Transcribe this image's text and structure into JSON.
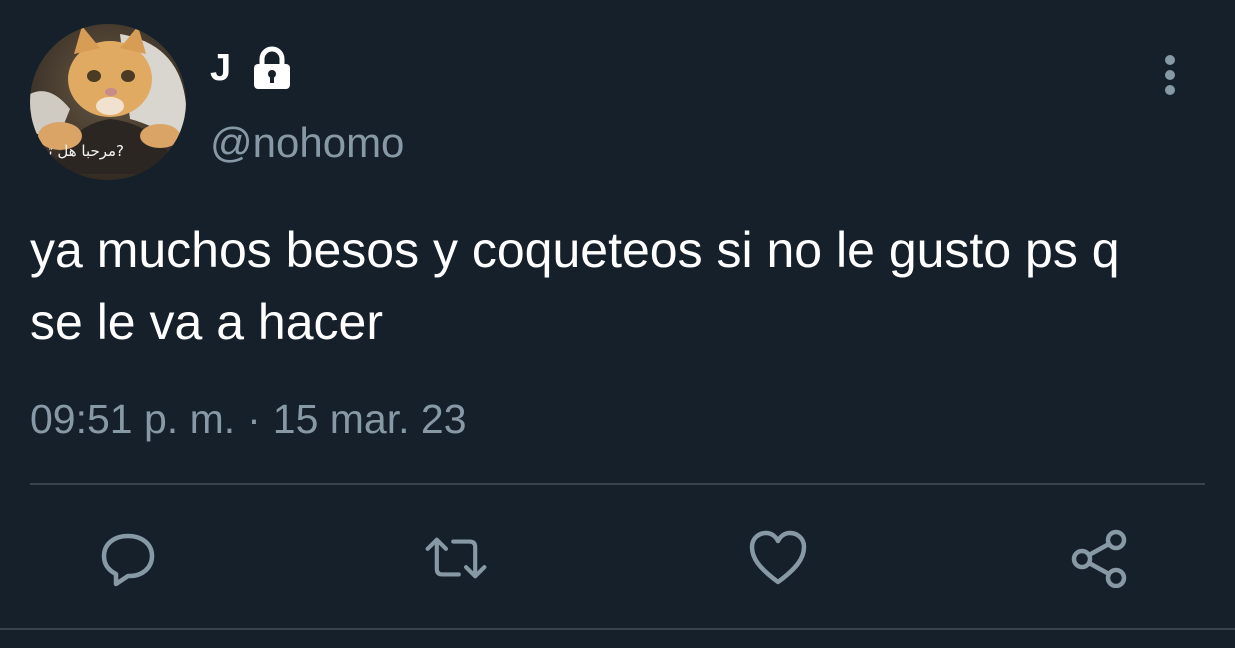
{
  "tweet": {
    "display_name": "J",
    "handle": "@nohomo",
    "avatar_caption": "?مرحبا هل تـ",
    "text": "ya muchos besos y coqueteos si no le gusto ps q se le va a hacer",
    "time": "09:51 p. m.",
    "separator": "·",
    "date": "15 mar. 23",
    "protected_icon": "lock-icon",
    "more_icon": "more-vertical-icon"
  },
  "actions": [
    {
      "name": "reply",
      "icon": "reply-icon"
    },
    {
      "name": "retweet",
      "icon": "retweet-icon"
    },
    {
      "name": "like",
      "icon": "heart-icon"
    },
    {
      "name": "share",
      "icon": "share-icon"
    }
  ],
  "colors": {
    "background": "#15202b",
    "text_primary": "#ffffff",
    "text_secondary": "#8899a6",
    "divider": "#38444d"
  }
}
